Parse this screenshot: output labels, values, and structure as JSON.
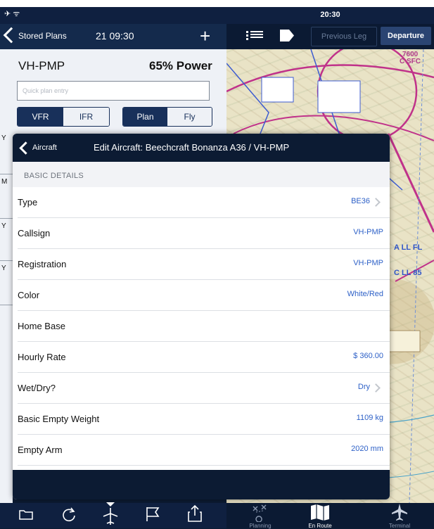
{
  "status_bar": {
    "icons": "✈ ᯤ",
    "time": "20:30"
  },
  "left_nav": {
    "back_label": "Stored Plans",
    "timestamp": "21 09:30",
    "add_label": "+"
  },
  "map_toolbar": {
    "prev_leg_label": "Previous Leg",
    "departure_label": "Departure"
  },
  "plan": {
    "registration": "VH-PMP",
    "power": "65% Power",
    "quick_entry_placeholder": "Quick plan entry",
    "rules": [
      "VFR",
      "IFR"
    ],
    "modes": [
      "Plan",
      "Fly"
    ]
  },
  "left_strip": {
    "letters": [
      "Y",
      "M",
      "Y",
      "Y"
    ]
  },
  "map": {
    "labels": [
      "7600",
      "C SFC",
      "A LL FL",
      "C LL 85"
    ]
  },
  "modal": {
    "back_label": "Aircraft",
    "title": "Edit Aircraft: Beechcraft Bonanza A36 / VH-PMP",
    "section_header": "BASIC DETAILS",
    "rows": [
      {
        "label": "Type",
        "value": "BE36",
        "chevron": true
      },
      {
        "label": "Callsign",
        "value": "VH-PMP",
        "chevron": false
      },
      {
        "label": "Registration",
        "value": "VH-PMP",
        "chevron": false
      },
      {
        "label": "Color",
        "value": "White/Red",
        "chevron": false
      },
      {
        "label": "Home Base",
        "value": "",
        "chevron": false
      },
      {
        "label": "Hourly Rate",
        "value": "$ 360.00",
        "chevron": false
      },
      {
        "label": "Wet/Dry?",
        "value": "Dry",
        "chevron": true
      },
      {
        "label": "Basic Empty Weight",
        "value": "1109 kg",
        "chevron": false
      },
      {
        "label": "Empty Arm",
        "value": "2020 mm",
        "chevron": false
      }
    ]
  },
  "tabs": {
    "left": [
      {
        "icon": "folder-icon"
      },
      {
        "icon": "refresh-icon"
      },
      {
        "icon": "airplane-icon"
      },
      {
        "icon": "flag-icon"
      },
      {
        "icon": "share-icon"
      }
    ],
    "right": [
      {
        "icon": "planning-icon",
        "label": "Planning"
      },
      {
        "icon": "map-book-icon",
        "label": "En Route"
      },
      {
        "icon": "plane-icon",
        "label": "Terminal"
      }
    ]
  },
  "colors": {
    "navy": "#0c1b33",
    "accent_blue": "#2e61c7",
    "airspace_magenta": "#c0328a"
  }
}
